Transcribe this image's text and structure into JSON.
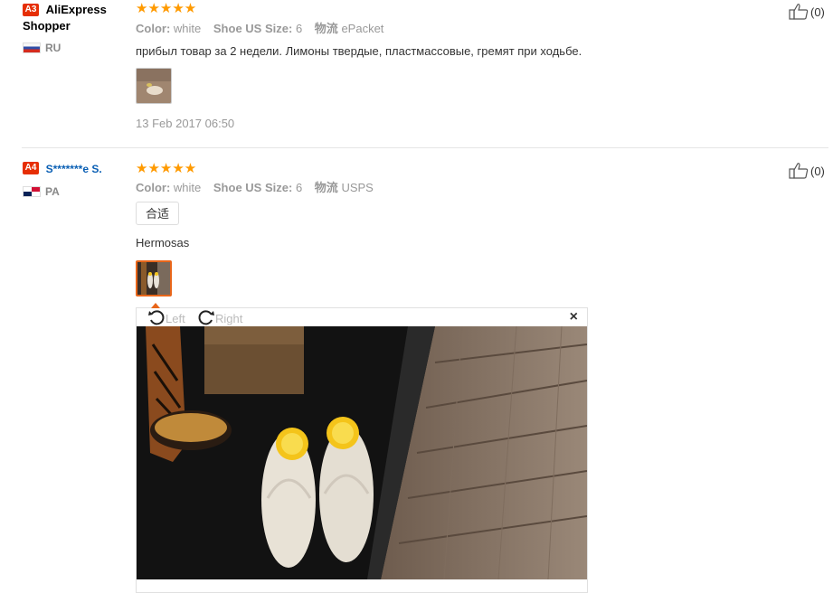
{
  "reviews": [
    {
      "badge": "A3",
      "buyer_name": "AliExpress Shopper",
      "country": "RU",
      "stars": "★★★★★",
      "color_label": "Color:",
      "color_value": "white",
      "size_label": "Shoe US Size:",
      "size_value": "6",
      "shipping_label": "物流",
      "shipping_value": "ePacket",
      "feedback": "прибыл товар за 2 недели. Лимоны твердые, пластмассовые, гремят при ходьбе.",
      "date": "13 Feb 2017 06:50",
      "useful": "(0)"
    },
    {
      "badge": "A4",
      "buyer_name": "S*******e S.",
      "country": "PA",
      "stars": "★★★★★",
      "color_label": "Color:",
      "color_value": "white",
      "size_label": "Shoe US Size:",
      "size_value": "6",
      "shipping_label": "物流",
      "shipping_value": "USPS",
      "tag": "合适",
      "feedback": "Hermosas",
      "useful": "(0)"
    }
  ],
  "viewer": {
    "rotate_left": "Left",
    "rotate_right": "Right",
    "close": "×"
  },
  "colors": {
    "star": "#ff9a00",
    "badge": "#e62e04",
    "link": "#0a5fb4",
    "active_thumb": "#e8661a"
  },
  "icons": [
    "thumbs-up-icon",
    "rotate-left-icon",
    "rotate-right-icon",
    "close-icon",
    "flag-ru-icon",
    "flag-pa-icon"
  ]
}
